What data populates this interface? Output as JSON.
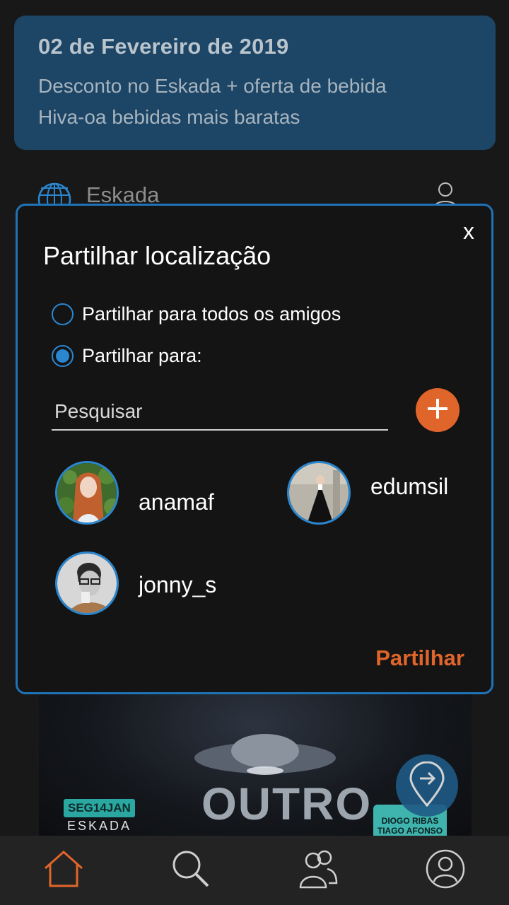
{
  "event": {
    "date": "02 de Fevereiro de 2019",
    "line1": "Desconto no Eskada + oferta de bebida",
    "line2": "Hiva-oa bebidas mais baratas"
  },
  "venue": {
    "name": "Eskada"
  },
  "poster": {
    "date_badge": "SEG14JAN",
    "brand": "ESKADA",
    "title": "OUTRO",
    "names": [
      "DIOGO RIBAS",
      "TIAGO AFONSO"
    ]
  },
  "modal": {
    "title": "Partilhar localização",
    "close_label": "x",
    "option_all": "Partilhar para todos os amigos",
    "option_some": "Partilhar para:",
    "selected_option": "option_some",
    "search_placeholder": "Pesquisar",
    "friends": [
      {
        "username": "anamaf"
      },
      {
        "username": "edumsil"
      },
      {
        "username": "jonny_s"
      }
    ],
    "share_label": "Partilhar"
  },
  "nav": {
    "items": [
      "home-icon",
      "search-icon",
      "friends-icon",
      "profile-icon"
    ],
    "active": "home-icon"
  },
  "colors": {
    "accent_orange": "#e0652a",
    "accent_blue": "#2a86cf",
    "card_blue": "#1c4566"
  }
}
